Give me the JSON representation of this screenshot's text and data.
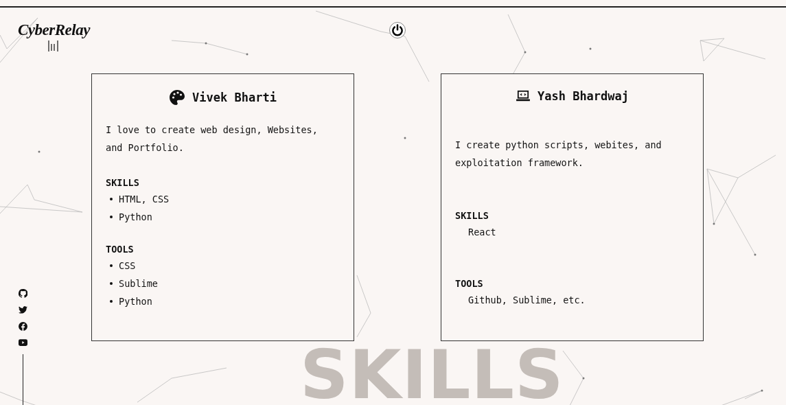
{
  "logo": {
    "text": "CyberRelay"
  },
  "cards": [
    {
      "name": "Vivek Bharti",
      "kind": "bulleted",
      "description": "I love to create web design, Websites, and Portfolio.",
      "sections": [
        {
          "heading": "SKILLS",
          "items": [
            "HTML, CSS",
            "Python"
          ]
        },
        {
          "heading": "TOOLS",
          "items": [
            "CSS",
            "Sublime",
            "Python"
          ]
        }
      ]
    },
    {
      "name": "Yash Bhardwaj",
      "kind": "plain",
      "description": "I create python scripts, webites, and exploitation framework.",
      "sections": [
        {
          "heading": "SKILLS",
          "items": [
            "React"
          ]
        },
        {
          "heading": "TOOLS",
          "items": [
            "Github, Sublime, etc."
          ]
        }
      ]
    }
  ],
  "background_title": "SKILLS"
}
